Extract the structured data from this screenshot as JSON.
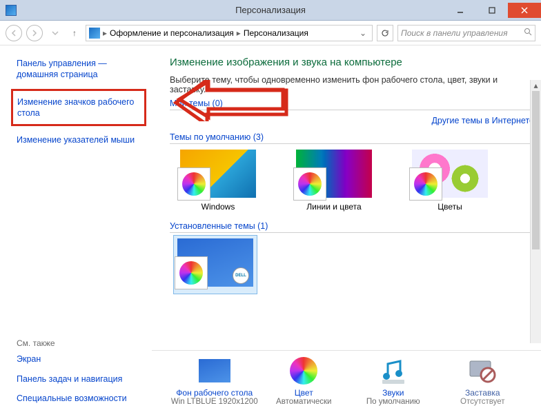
{
  "window": {
    "title": "Персонализация"
  },
  "breadcrumb": {
    "seg1": "Оформление и персонализация",
    "seg2": "Персонализация"
  },
  "search": {
    "placeholder": "Поиск в панели управления"
  },
  "sidebar": {
    "home": "Панель управления — домашняя страница",
    "desktop_icons": "Изменение значков рабочего стола",
    "mouse_pointers": "Изменение указателей мыши",
    "see_also": "См. также",
    "screen": "Экран",
    "taskbar": "Панель задач и навигация",
    "ease": "Специальные возможности"
  },
  "main": {
    "heading": "Изменение изображения и звука на компьютере",
    "sub": "Выберите тему, чтобы одновременно изменить фон рабочего стола, цвет, звуки и заставку.",
    "my_themes": "Мои темы (0)",
    "online": "Другие темы в Интернете",
    "default_themes": "Темы по умолчанию (3)",
    "installed_themes": "Установленные темы (1)",
    "themes": {
      "t1": "Windows",
      "t2": "Линии и цвета",
      "t3": "Цветы"
    }
  },
  "bottom": {
    "bg_label": "Фон рабочего стола",
    "bg_value": "Win LTBLUE 1920x1200",
    "color_label": "Цвет",
    "color_value": "Автоматически",
    "sound_label": "Звуки",
    "sound_value": "По умолчанию",
    "saver_label": "Заставка",
    "saver_value": "Отсутствует"
  }
}
